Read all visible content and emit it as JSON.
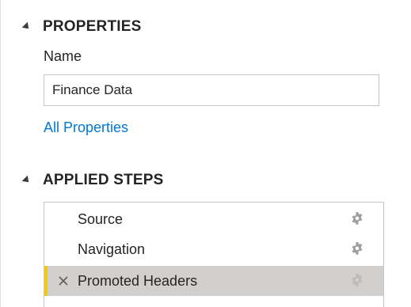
{
  "properties": {
    "section_title": "PROPERTIES",
    "name_label": "Name",
    "name_value": "Finance Data",
    "all_properties_link": "All Properties"
  },
  "applied_steps": {
    "section_title": "APPLIED STEPS",
    "steps": [
      {
        "label": "Source",
        "selected": false,
        "has_settings": true
      },
      {
        "label": "Navigation",
        "selected": false,
        "has_settings": true
      },
      {
        "label": "Promoted Headers",
        "selected": true,
        "has_settings": true
      }
    ]
  },
  "colors": {
    "accent_link": "#0078d4",
    "selected_row": "#d2d0ce",
    "selected_marker": "#f2c811",
    "gear_icon": "#a19f9d"
  },
  "icons": {
    "section_caret": "caret-collapse-icon",
    "step_settings": "gear-icon",
    "step_delete": "close-icon"
  }
}
